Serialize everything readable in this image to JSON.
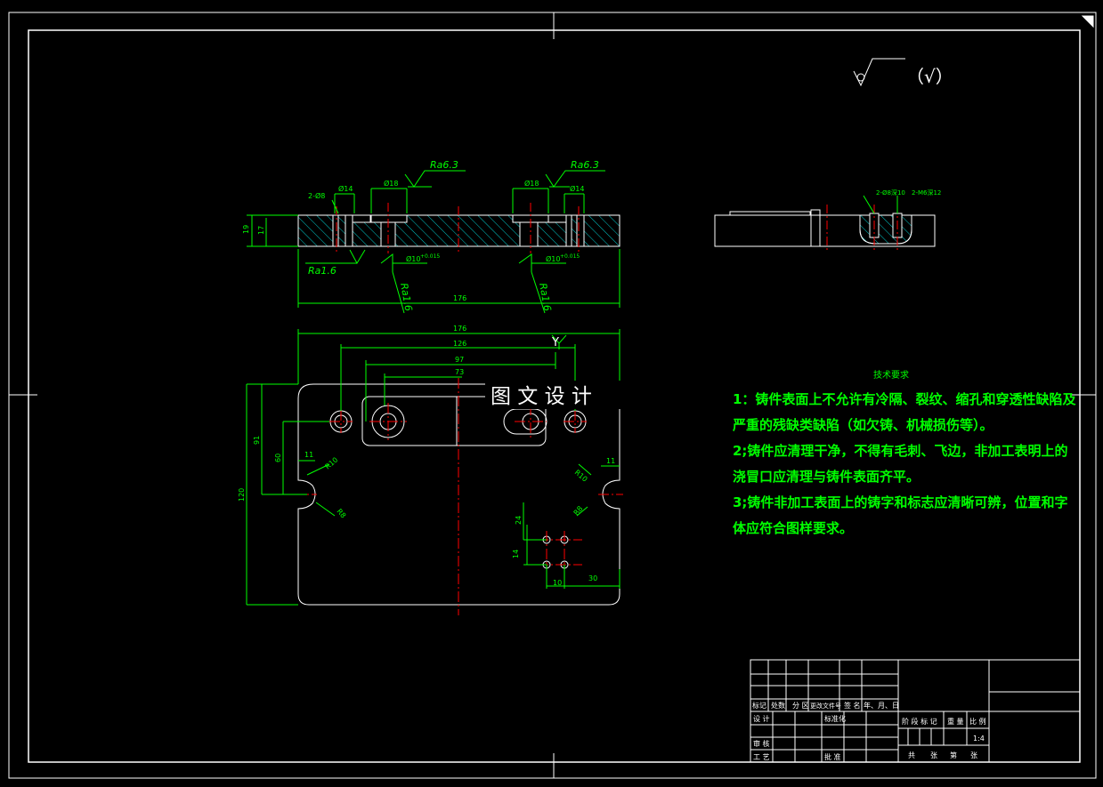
{
  "finish_symbol": {
    "note": "（√）"
  },
  "section_view": {
    "surface_roughness_top_left": "Ra6.3",
    "surface_roughness_top_right": "Ra6.3",
    "roughness_bottom_left": "Ra1.6",
    "roughness_bottom_mid_left": "Ra1.6",
    "roughness_bottom_mid_right": "Ra1.6",
    "dim_hole_small_left": "Ø14",
    "dim_hole_small_right": "Ø14",
    "dim_counterbore_left": "Ø18",
    "dim_counterbore_right": "Ø18",
    "dim_chamfer": "2-Ø8",
    "dim_bore_left": "Ø10",
    "dim_bore_right": "Ø10",
    "dim_bore_tolerance": "+0.015",
    "dim_height_total": "19",
    "dim_height_inner": "17",
    "dim_length": "176"
  },
  "side_view": {
    "label_1": "2-Ø8深10",
    "label_2": "2-M6深12"
  },
  "plan_view": {
    "dim_overall": "176",
    "dim_126": "126",
    "dim_97": "97",
    "dim_73": "73",
    "axis_label": "Y",
    "dim_height": "120",
    "dim_91": "91",
    "dim_60": "60",
    "dim_11_left": "11",
    "dim_11_right": "11",
    "dim_r10_left": "R10",
    "dim_r10_right": "R10",
    "dim_r8_left": "R8",
    "dim_r8_right": "R8",
    "dim_24": "24",
    "dim_14": "14",
    "dim_10": "10",
    "dim_30": "30"
  },
  "watermark": "图 文 设 计",
  "tech_requirements": {
    "title": "技术要求",
    "lines": [
      "1：铸件表面上不允许有冷隔、裂纹、缩孔和穿透性缺陷及",
      "严重的残缺类缺陷（如欠铸、机械损伤等）。",
      "2;铸件应清理干净，不得有毛刺、飞边，非加工表明上的",
      "浇冒口应清理与铸件表面齐平。",
      "3;铸件非加工表面上的铸字和标志应清晰可辨，位置和字",
      "体应符合图样要求。"
    ]
  },
  "title_block": {
    "row_headers": [
      "标记",
      "处数",
      "分 区",
      "更改文件号",
      "签 名",
      "年、月、日"
    ],
    "design": "设 计",
    "standardize": "标准化",
    "review": "审 核",
    "process": "工 艺",
    "approve": "批 准",
    "stage_mark": "阶 段 标 记",
    "weight": "重 量",
    "scale_label": "比 例",
    "scale_value": "1:4",
    "sheets": [
      "共",
      "张",
      "第",
      "张"
    ]
  },
  "colors": {
    "background": "#000000",
    "outline": "#ffffff",
    "dimension": "#00ff00",
    "center_line": "#ff0000",
    "hatch": "#00c8c8",
    "text_green": "#00ff00"
  }
}
